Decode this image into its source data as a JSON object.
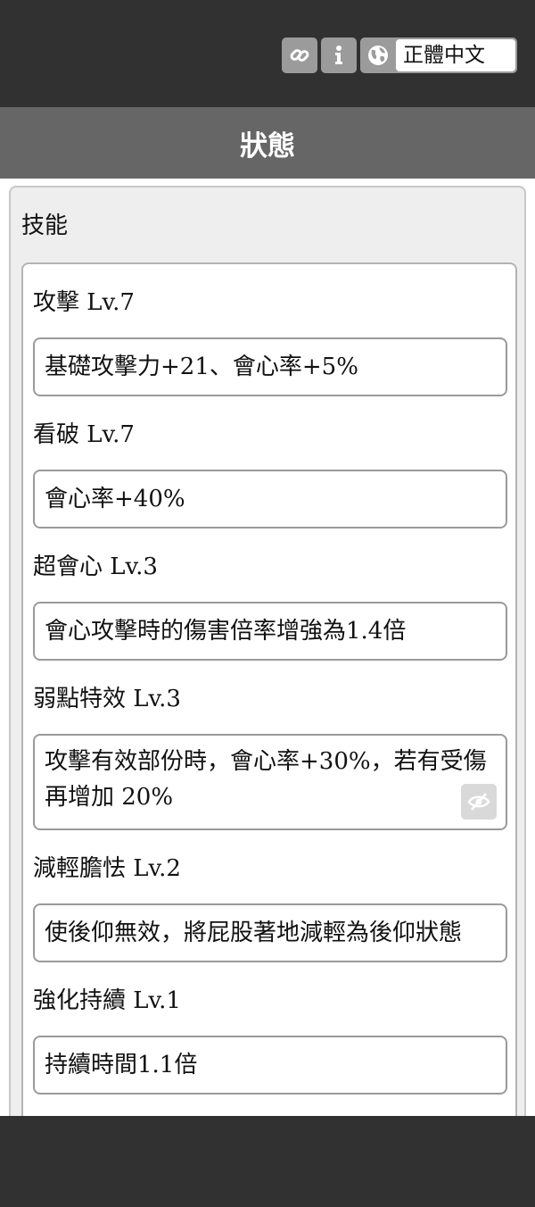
{
  "header": {
    "link_icon": "link-icon",
    "info_icon": "info-icon",
    "globe_icon": "globe-icon",
    "language": "正體中文"
  },
  "title": "狀態",
  "panel": {
    "title": "技能",
    "skills": [
      {
        "name": "攻擊 Lv.7",
        "desc": "基礎攻擊力+21、會心率+5%"
      },
      {
        "name": "看破 Lv.7",
        "desc": "會心率+40%"
      },
      {
        "name": "超會心 Lv.3",
        "desc": "會心攻擊時的傷害倍率增強為1.4倍"
      },
      {
        "name": "弱點特效 Lv.3",
        "desc": "攻擊有效部份時，會心率+30%，若有受傷再增加 20%"
      },
      {
        "name": "減輕膽怯 Lv.2",
        "desc": "使後仰無效，將屁股著地減輕為後仰狀態"
      },
      {
        "name": "強化持續 Lv.1",
        "desc": "持續時間1.1倍"
      }
    ],
    "hide_icon": "eye-slash-icon"
  }
}
